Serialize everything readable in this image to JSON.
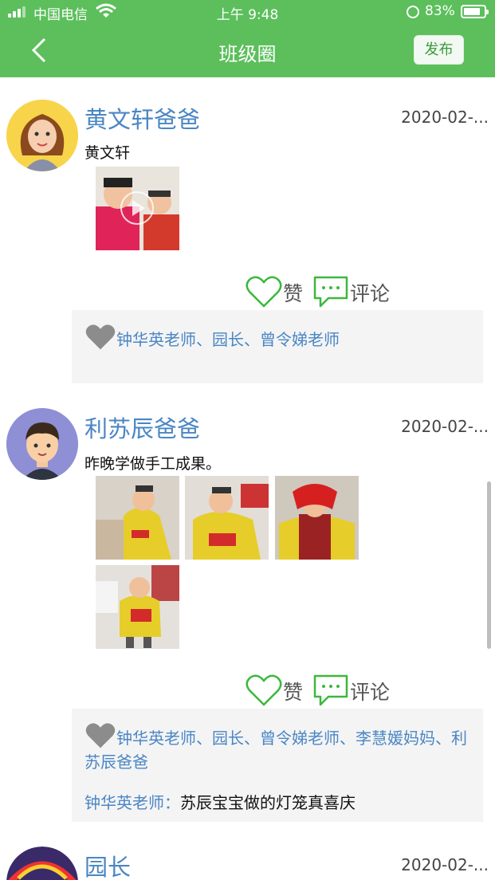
{
  "status_bar": {
    "carrier": "中国电信",
    "time": "上午 9:48",
    "battery": "83%",
    "battery_level": 0.83
  },
  "nav": {
    "title": "班级圈",
    "publish_label": "发布"
  },
  "actions": {
    "like_label": "赞",
    "comment_label": "评论"
  },
  "posts": [
    {
      "author": "黄文轩爸爸",
      "date": "2020-02-...",
      "text": "黄文轩",
      "likes": "钟华英老师、园长、曾令娣老师"
    },
    {
      "author": "利苏辰爸爸",
      "date": "2020-02-...",
      "text": "昨晚学做手工成果。",
      "likes": "钟华英老师、园长、曾令娣老师、李慧媛妈妈、利苏辰爸爸",
      "comment": {
        "name": "钟华英老师：",
        "text": "苏辰宝宝做的灯笼真喜庆"
      }
    },
    {
      "author": "园长",
      "date": "2020-02-..."
    }
  ],
  "colors": {
    "header": "#5cbf5c",
    "author_blue": "#4a86c4",
    "like_green": "#3cb83c",
    "panel": "#f4f4f4"
  }
}
